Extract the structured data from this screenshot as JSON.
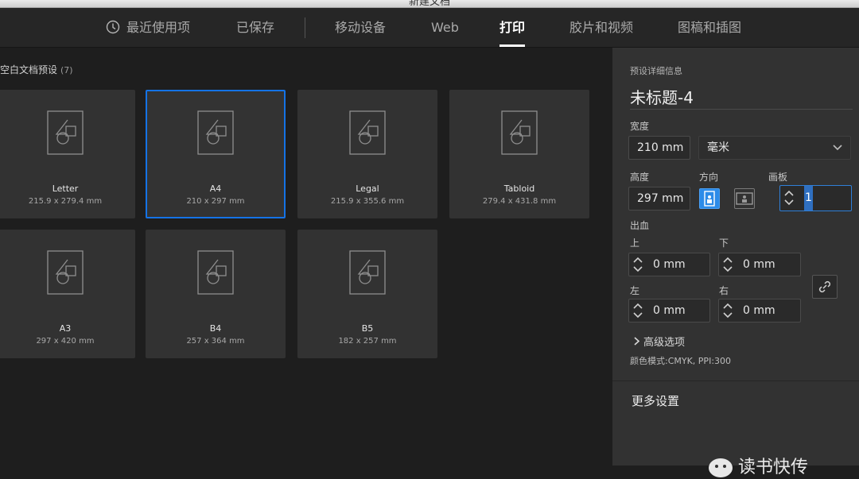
{
  "window": {
    "title": "新建文档"
  },
  "tabs": [
    {
      "label": "最近使用项",
      "icon": "clock-icon"
    },
    {
      "label": "已保存"
    },
    {
      "label": "移动设备"
    },
    {
      "label": "Web"
    },
    {
      "label": "打印",
      "active": true
    },
    {
      "label": "胶片和视频"
    },
    {
      "label": "图稿和插图"
    }
  ],
  "presets": {
    "title": "空白文档预设",
    "count": "(7)",
    "items": [
      {
        "name": "Letter",
        "dims": "215.9 x 279.4 mm"
      },
      {
        "name": "A4",
        "dims": "210 x 297 mm",
        "selected": true
      },
      {
        "name": "Legal",
        "dims": "215.9 x 355.6 mm"
      },
      {
        "name": "Tabloid",
        "dims": "279.4 x 431.8 mm"
      },
      {
        "name": "A3",
        "dims": "297 x 420 mm"
      },
      {
        "name": "B4",
        "dims": "257 x 364 mm"
      },
      {
        "name": "B5",
        "dims": "182 x 257 mm"
      }
    ]
  },
  "details": {
    "header": "预设详细信息",
    "doc_name": "未标题-4",
    "width_label": "宽度",
    "width_value": "210 mm",
    "unit_value": "毫米",
    "height_label": "高度",
    "height_value": "297 mm",
    "orientation_label": "方向",
    "artboard_label": "画板",
    "artboard_value": "1",
    "bleed_label": "出血",
    "bleed": {
      "top_label": "上",
      "top_value": "0 mm",
      "bottom_label": "下",
      "bottom_value": "0 mm",
      "left_label": "左",
      "left_value": "0 mm",
      "right_label": "右",
      "right_value": "0 mm"
    },
    "advanced_label": "高级选项",
    "color_mode": "颜色模式:CMYK, PPI:300",
    "more_settings": "更多设置"
  },
  "watermark": "读书快传",
  "colors": {
    "accent": "#1473e6",
    "panel": "#323232",
    "background": "#1e1e1e"
  }
}
